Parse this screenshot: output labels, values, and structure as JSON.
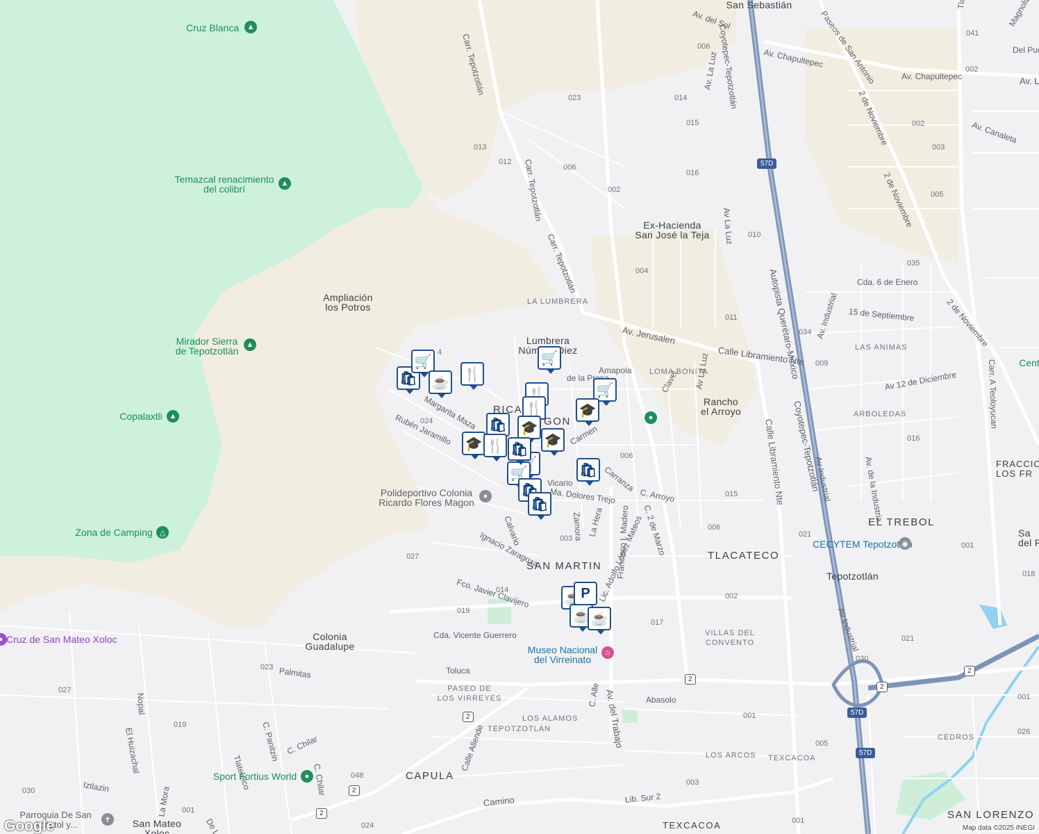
{
  "map": {
    "attribution": "Map data ©2025 INEGI",
    "logo": "Google",
    "colors": {
      "park_green": "#cdf1dd",
      "land_tan": "#f1ede0",
      "road": "#ffffff",
      "highway": "#7d93b8",
      "water": "#8fd3f0",
      "pin_border": "#1f4e8c"
    },
    "area_labels": [
      "San Sebastián",
      "Ex-Hacienda\nSan José la Teja",
      "Ampliación\nlos Potros",
      "Lumbrera\nNúmero Diez",
      "Rancho\nel Arroyo",
      "LOMA BONITA",
      "LA LUMBRERA",
      "SAN MARTIN",
      "TLACATECO",
      "EL TREBOL",
      "Tepotzotlán",
      "Colonia\nGuadalupe",
      "CAPULA",
      "LOS ALAMOS",
      "TEPOTZOTLAN",
      "PASEO DE\nLOS VIRREYES",
      "VILLAS DEL\nCONVENTO",
      "LOS ARCOS",
      "TEXCACOA",
      "TEXCACOA",
      "SAN LORENZO",
      "LAS ANIMAS",
      "ARBOLEDAS",
      "FRACCION\nLOS FR",
      "CEDROS",
      "San Mateo\nXoloc",
      "RICA",
      "GON",
      "Sa\ndel P",
      "Cent"
    ],
    "street_labels": [
      "Carr. Tepotzotlán",
      "Carr. Tepotzotlán",
      "Carr. Tepotzotlán",
      "Av. del Sol",
      "Coyotepec-Tepotzotlán",
      "Paseos de San Antonio",
      "Av. Chapultepec",
      "Av. Chapultepec",
      "Av. La Luz",
      "Av La Luz",
      "Av La Luz",
      "Av. Jerusalen",
      "Calle Libramiento Nte",
      "Calle Libramiento Nte",
      "Autopista Querétaro-México",
      "Coyotepec-Tepotzotlán",
      "2 de Noviembre",
      "2 de Noviembre",
      "2 de Noviembre",
      "Av. Canaleta",
      "Av. Industrial",
      "Av Industrial",
      "Av Industrial",
      "15 de Septiembre",
      "Cda. 6 de Enero",
      "Av 12 de Diciembre",
      "Av. de la Industria",
      "Carr. A Teoloyucan",
      "Tlalpan",
      "Magnolia",
      "Del Puer",
      "Av. L",
      "Amapola",
      "Clavel",
      "de la Presa",
      "Carranza",
      "C. Arroyo",
      "C. 2 de Marzo",
      "Zamora",
      "La Hera",
      "Lic. Adolfo López Mateos",
      "Francisco I. Madero",
      "Calvario",
      "Ignacio Zaragoza",
      "Fco. Javier Clavijero",
      "Cda. Vicente Guerrero",
      "Toluca",
      "Av. del Trabajo",
      "C. Alle",
      "Abasolo",
      "Calle Allende",
      "Camino",
      "Lib. Sur 2",
      "Rubén Jaramillo",
      "Margarita Maza",
      "Vicario",
      "Ma. Dolores Trejo",
      "Carmen",
      "Palmitas",
      "Nopal",
      "El Huizachal",
      "Tlatelolco",
      "C. Panitzin",
      "C. Chilar",
      "C. Chilar",
      "Iztlazin",
      "La Mora",
      "De Los"
    ],
    "block_numbers": [
      "006",
      "023",
      "014",
      "015",
      "013",
      "012",
      "006",
      "002",
      "016",
      "010",
      "004",
      "011",
      "034",
      "009",
      "035",
      "002",
      "003",
      "005",
      "041",
      "002",
      "016",
      "021",
      "015",
      "006",
      "006",
      "003",
      "027",
      "014",
      "019",
      "002",
      "017",
      "001",
      "005",
      "003",
      "024",
      "048",
      "019",
      "001",
      "027",
      "023",
      "030",
      "001",
      "030",
      "021",
      "001",
      "018",
      "026",
      "001",
      "024",
      "4"
    ],
    "parks": [
      {
        "name": "Cruz Blanca",
        "icon": "tree-icon"
      },
      {
        "name": "Temazcal renacimiento\ndel colibrí",
        "icon": "tree-icon"
      },
      {
        "name": "Mirador Sierra\nde Tepotzotlán",
        "icon": "tree-icon"
      },
      {
        "name": "Copalaxtli",
        "icon": "tree-icon"
      },
      {
        "name": "Zona de Camping",
        "icon": "camping-icon"
      },
      {
        "name": "Sport Fortius World",
        "icon": "stadium-icon"
      }
    ],
    "pois": [
      {
        "name": "Polideportivo Colonia\nRicardo Flores Magon",
        "icon": "place-icon"
      },
      {
        "name": "Museo Nacional\ndel Virreinato",
        "icon": "museum-icon"
      },
      {
        "name": "CECYTEM Tepotzotlan",
        "icon": "school-icon"
      },
      {
        "name": "Cruz de San Mateo Xoloc",
        "icon": "landmark-icon"
      },
      {
        "name": "Parroquia De San\nApóstol y...",
        "icon": "church-icon"
      }
    ],
    "route_shields": [
      "57D",
      "57D",
      "57D",
      "2",
      "2",
      "2",
      "2",
      "2",
      "2"
    ],
    "markers": [
      "shopping-bag-icon",
      "shopping-cart-icon",
      "cafe-icon",
      "restaurant-icon",
      "shopping-cart-icon",
      "restaurant-icon",
      "restaurant-icon",
      "shopping-cart-icon",
      "school-icon",
      "school-icon",
      "school-icon",
      "school-icon",
      "shopping-bag-icon",
      "restaurant-icon",
      "shopping-cart-icon",
      "shopping-cart-icon",
      "shopping-bag-icon",
      "shopping-bag-icon",
      "shopping-bag-icon",
      "shopping-bag-icon",
      "cafe-icon",
      "parking-icon",
      "cafe-icon",
      "cafe-icon"
    ]
  }
}
